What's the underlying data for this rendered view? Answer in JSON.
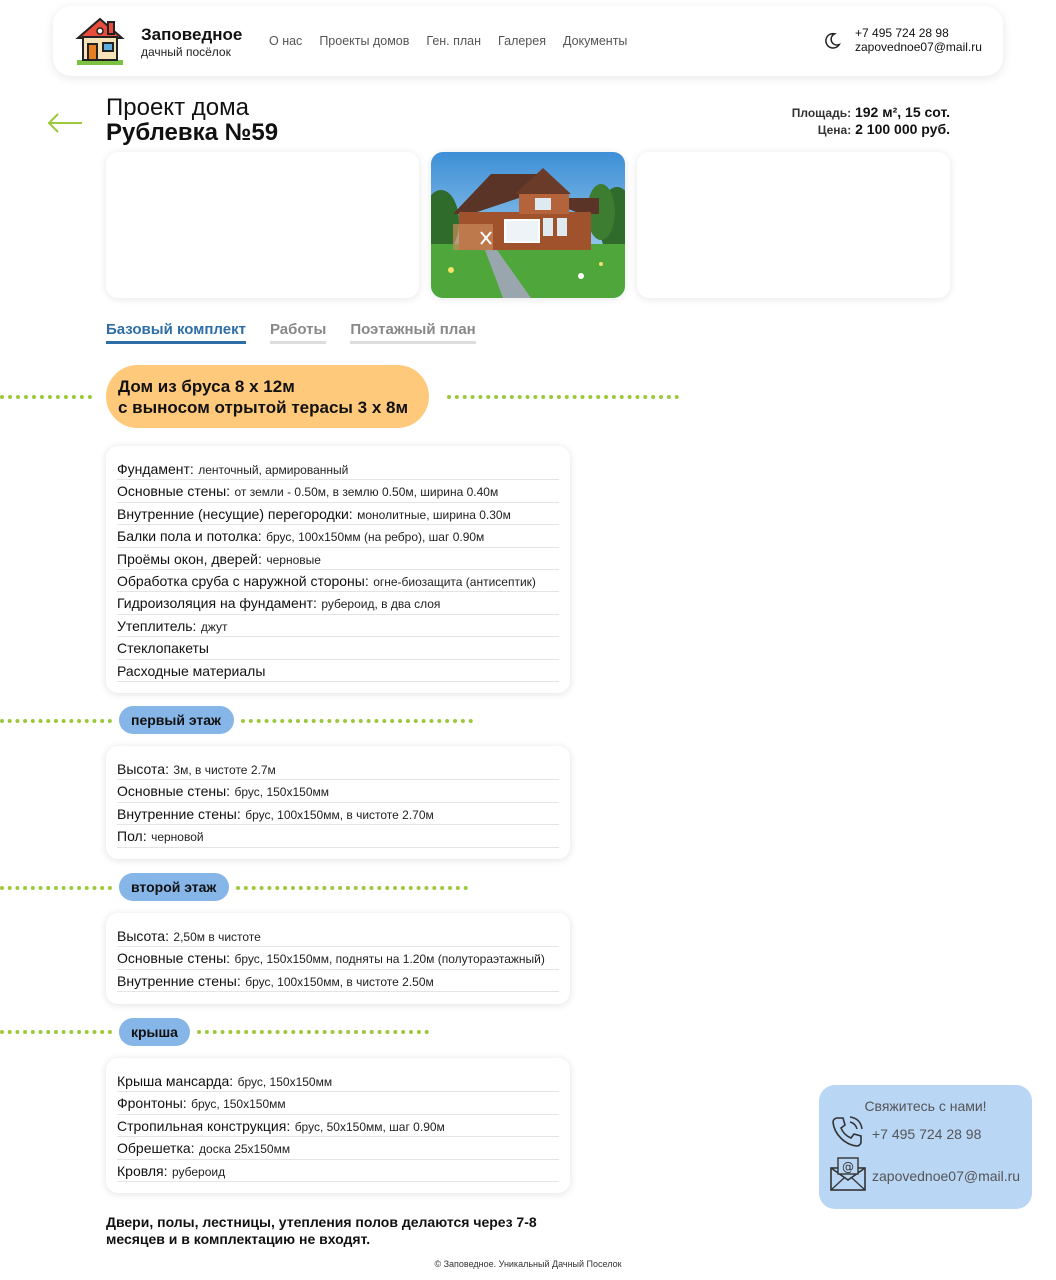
{
  "header": {
    "brand_title": "Заповедное",
    "brand_subtitle": "дачный посёлок",
    "nav": [
      "О нас",
      "Проекты домов",
      "Ген. план",
      "Галерея",
      "Документы"
    ],
    "phone": "+7 495 724 28 98",
    "email": "zapovednoe07@mail.ru"
  },
  "project": {
    "title_prefix": "Проект дома",
    "title_name": "Рублевка №59",
    "area_label": "Площадь:",
    "area_value": "192 м², 15 сот.",
    "price_label": "Цена:",
    "price_value": "2 100 000 руб."
  },
  "tabs": [
    "Базовый комплект",
    "Работы",
    "Поэтажный план"
  ],
  "main_heading": {
    "line1": "Дом из бруса 8 х 12м",
    "line2": "с выносом отрытой терасы 3 х 8м"
  },
  "base_specs": [
    {
      "k": "Фундамент:",
      "v": "ленточный, армированный"
    },
    {
      "k": "Основные стены:",
      "v": "от земли - 0.50м, в землю 0.50м, ширина 0.40м"
    },
    {
      "k": "Внутренние (несущие) перегородки:",
      "v": "монолитные, ширина 0.30м"
    },
    {
      "k": "Балки пола и потолка:",
      "v": "брус, 100х150мм (на ребро), шаг 0.90м"
    },
    {
      "k": "Проёмы окон, дверей:",
      "v": "черновые"
    },
    {
      "k": "Обработка сруба с наружной стороны:",
      "v": "огне-биозащита (антисептик)"
    },
    {
      "k": "Гидроизоляция на фундамент:",
      "v": "рубероид, в два слоя"
    },
    {
      "k": "Утеплитель:",
      "v": "джут"
    },
    {
      "k": "Стеклопакеты",
      "v": ""
    },
    {
      "k": "Расходные материалы",
      "v": ""
    }
  ],
  "first_floor": {
    "label": "первый этаж",
    "specs": [
      {
        "k": "Высота:",
        "v": "3м, в чистоте 2.7м"
      },
      {
        "k": "Основные стены:",
        "v": "брус, 150х150мм"
      },
      {
        "k": "Внутренние стены:",
        "v": "брус, 100х150мм, в чистоте 2.70м"
      },
      {
        "k": "Пол:",
        "v": "черновой"
      }
    ]
  },
  "second_floor": {
    "label": "второй этаж",
    "specs": [
      {
        "k": "Высота:",
        "v": "2,50м в чистоте"
      },
      {
        "k": "Основные стены:",
        "v": "брус, 150х150мм, подняты на 1.20м (полутораэтажный)"
      },
      {
        "k": "Внутренние стены:",
        "v": "брус, 100х150мм, в чистоте 2.50м"
      }
    ]
  },
  "roof": {
    "label": "крыша",
    "specs": [
      {
        "k": "Крыша мансарда:",
        "v": "брус, 150х150мм"
      },
      {
        "k": "Фронтоны:",
        "v": "брус, 150х150мм"
      },
      {
        "k": "Стропильная конструкция:",
        "v": "брус, 50х150мм, шаг 0.90м"
      },
      {
        "k": "Обрешетка:",
        "v": "доска 25х150мм"
      },
      {
        "k": "Кровля:",
        "v": "рубероид"
      }
    ]
  },
  "note": "Двери, полы, лестницы, утепления полов делаются через 7-8 месяцев и в комплектацию не входят.",
  "footer": "© Заповедное. Уникальный Дачный Поселок",
  "contact_widget": {
    "title": "Свяжитесь с нами!",
    "phone": "+7 495 724 28 98",
    "email": "zapovednoe07@mail.ru"
  },
  "colors": {
    "accent_green": "#9cc83c",
    "main_pill": "#ffc97c",
    "section_pill": "#86b5e8",
    "tab_active": "#2e6ea6",
    "contact_bg": "#b9d6f5"
  }
}
